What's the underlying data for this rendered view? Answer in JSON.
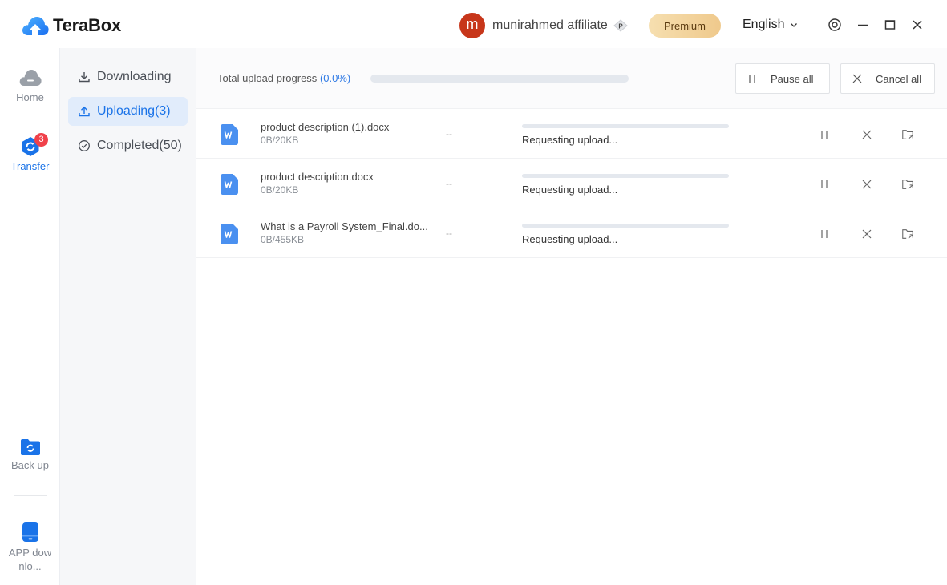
{
  "app": {
    "name": "TeraBox",
    "brand_color": "#2f7ae5"
  },
  "header": {
    "user": {
      "avatar_letter": "m",
      "avatar_color": "#c7361a",
      "name": "munirahmed affiliate",
      "vip_badge": "P"
    },
    "premium_label": "Premium",
    "language": "English",
    "icons": [
      "settings-icon",
      "minimize-icon",
      "maximize-icon",
      "close-icon"
    ]
  },
  "left_nav": {
    "items": [
      {
        "label": "Home",
        "icon": "home-cloud-icon",
        "active": false
      },
      {
        "label": "Transfer",
        "icon": "transfer-icon",
        "active": true,
        "badge": "3"
      },
      {
        "label": "Back up",
        "icon": "backup-folder-icon",
        "active": false
      },
      {
        "label": "APP downlo...",
        "icon": "phone-icon",
        "active": false
      }
    ]
  },
  "sub_nav": {
    "items": [
      {
        "label": "Downloading",
        "icon": "download-icon",
        "active": false
      },
      {
        "label": "Uploading(3)",
        "icon": "upload-icon",
        "active": true
      },
      {
        "label": "Completed(50)",
        "icon": "check-circle-icon",
        "active": false
      }
    ]
  },
  "toolbar": {
    "total_label": "Total upload progress",
    "total_percent_text": "(0.0%)",
    "total_progress": 0.0,
    "pause_all_label": "Pause all",
    "cancel_all_label": "Cancel all"
  },
  "uploads": [
    {
      "name": "product description (1).docx",
      "size": "0B/20KB",
      "speed": "--",
      "status": "Requesting upload...",
      "progress": 0
    },
    {
      "name": "product description.docx",
      "size": "0B/20KB",
      "speed": "--",
      "status": "Requesting upload...",
      "progress": 0
    },
    {
      "name": "What is a Payroll System_Final.do...",
      "size": "0B/455KB",
      "speed": "--",
      "status": "Requesting upload...",
      "progress": 0
    }
  ]
}
